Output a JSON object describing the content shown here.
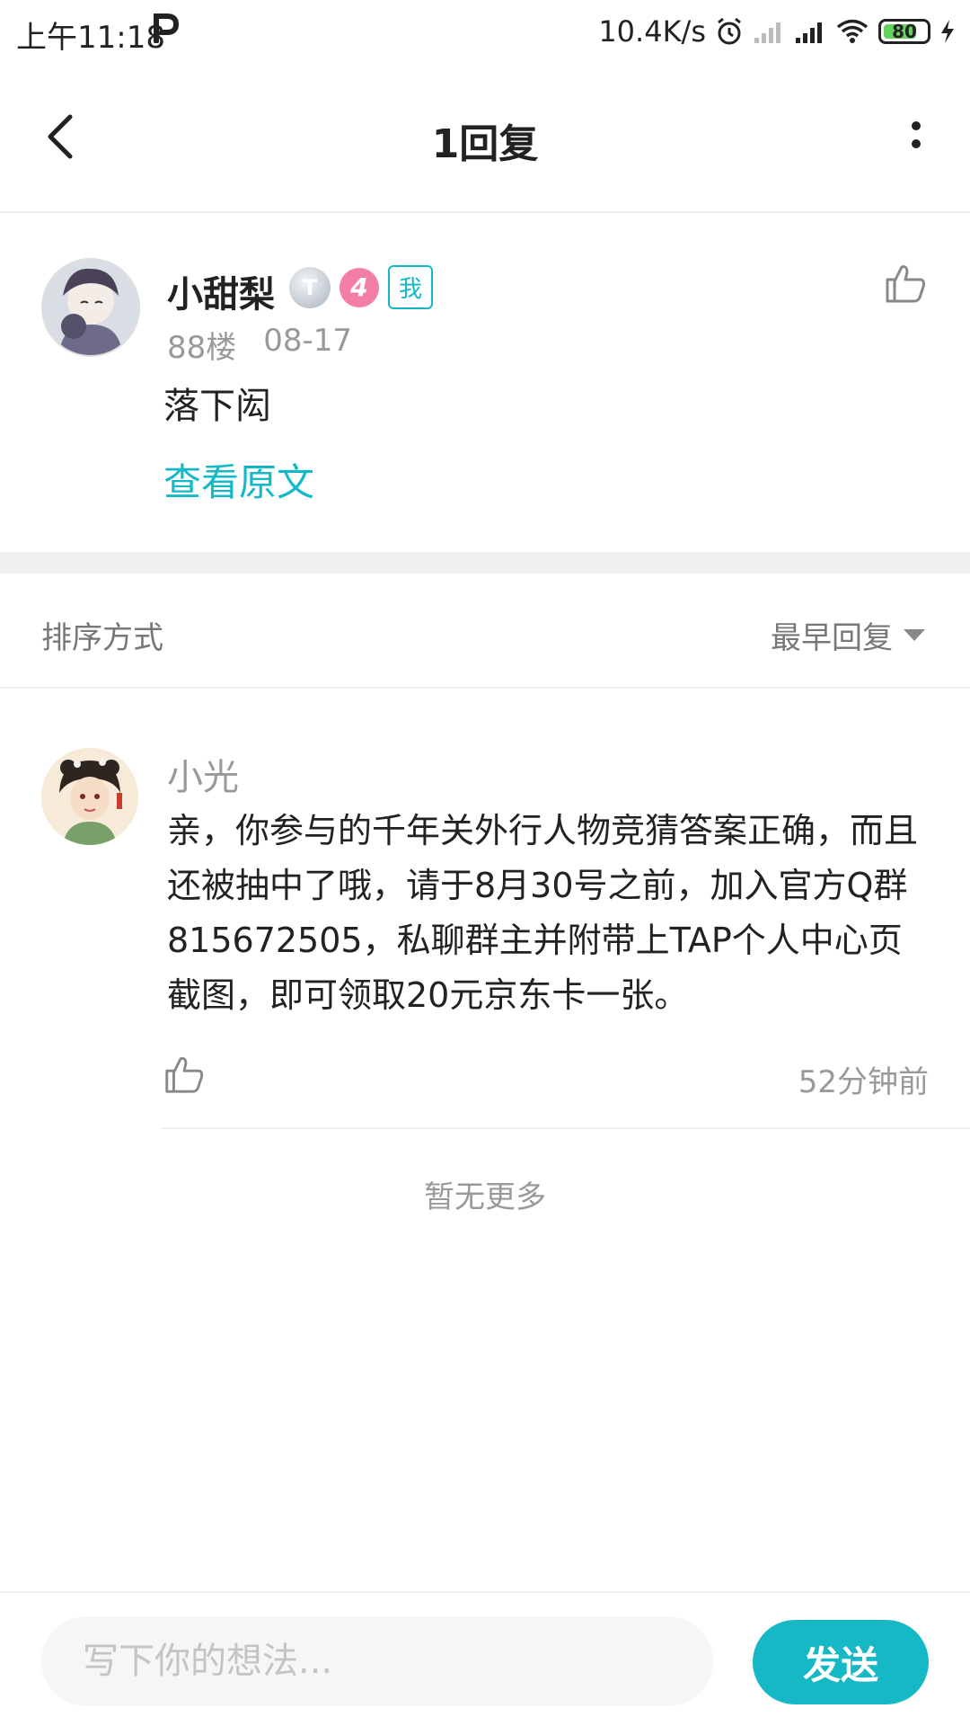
{
  "status_bar": {
    "time": "上午11:18",
    "network_speed": "10.4K/s",
    "battery": "80",
    "icons": [
      "parking-p-icon",
      "alarm-icon",
      "signal-weak-icon",
      "signal-icon",
      "wifi-icon",
      "battery-icon",
      "charging-icon"
    ]
  },
  "header": {
    "title": "1回复",
    "back_icon": "chevron-left-icon",
    "more_icon": "more-vertical-icon"
  },
  "post": {
    "username": "小甜梨",
    "badge_tier": "T",
    "badge_level": "4",
    "badge_me": "我",
    "floor": "88楼",
    "date": "08-17",
    "content": "落下闳",
    "view_original": "查看原文",
    "like_icon": "thumbs-up-icon"
  },
  "sort": {
    "label": "排序方式",
    "selected": "最早回复"
  },
  "reply": {
    "username": "小光",
    "text": "亲，你参与的千年关外行人物竞猜答案正确，而且还被抽中了哦，请于8月30号之前，加入官方Q群815672505，私聊群主并附带上TAP个人中心页截图，即可领取20元京东卡一张。",
    "time": "52分钟前"
  },
  "footer": {
    "no_more": "暂无更多"
  },
  "composer": {
    "placeholder": "写下你的想法...",
    "send_label": "发送"
  },
  "colors": {
    "accent": "#17b8c5",
    "level_badge": "#f47fa6",
    "muted_text": "#999999"
  }
}
